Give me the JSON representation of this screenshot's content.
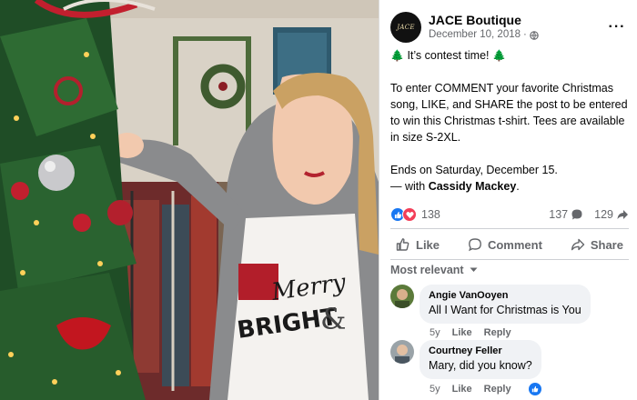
{
  "post": {
    "author": "JACE Boutique",
    "avatar_text": "JACE",
    "date": "December 10, 2018",
    "meta_separator": "·",
    "more_label": "···",
    "body": {
      "headline": "It’s contest time!",
      "paragraph": "To enter COMMENT your favorite Christmas song, LIKE, and SHARE the post to be entered to win this Christmas t-shirt. Tees are available in size S-2XL.",
      "ends": "Ends on Saturday, December 15.",
      "with_prefix": "— with ",
      "tagged": "Cassidy Mackey",
      "with_suffix": "."
    },
    "reaction_count": "138",
    "comment_count": "137",
    "share_count": "129",
    "actions": {
      "like": "Like",
      "comment": "Comment",
      "share": "Share"
    }
  },
  "comments_section": {
    "sort_label": "Most relevant",
    "comments": [
      {
        "name": "Angie VanOoyen",
        "text": "All I Want for Christmas is You",
        "time": "5y",
        "like_label": "Like",
        "reply_label": "Reply"
      },
      {
        "name": "Courtney Feller",
        "text": "Mary, did you know?",
        "time": "5y",
        "like_label": "Like",
        "reply_label": "Reply"
      }
    ]
  },
  "photo": {
    "shirt_text_line1": "Merry",
    "shirt_text_line2": "BRIGHT",
    "shirt_text_amp": "&"
  },
  "colors": {
    "accent_blue": "#1877f2",
    "love_red": "#f33e58",
    "muted_text": "#65676b",
    "bubble_bg": "#f0f2f5"
  },
  "icons": {
    "like_reaction": "thumbs-up-icon",
    "love_reaction": "heart-icon",
    "comment_stat": "speech-bubble-icon",
    "share_stat": "share-arrow-icon",
    "privacy": "globe-icon",
    "sort": "caret-down-icon",
    "emoji": "christmas-tree-icon"
  }
}
